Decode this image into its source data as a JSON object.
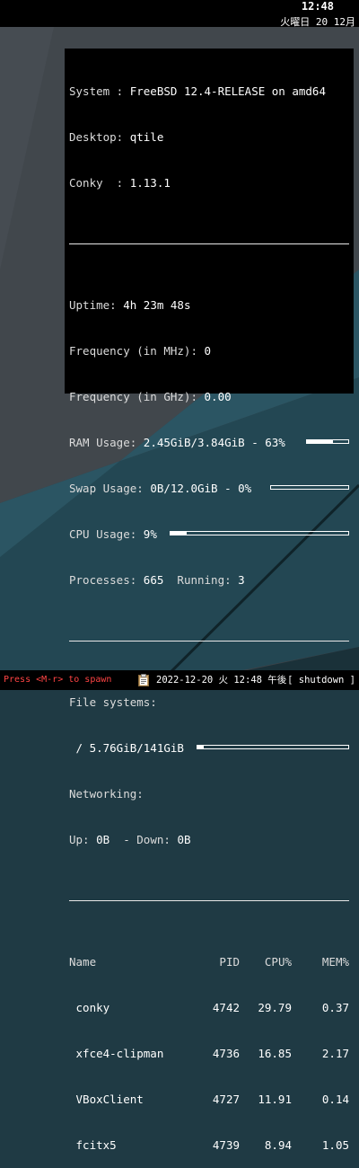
{
  "clock": {
    "time": "12:48",
    "date": "火曜日 20 12月"
  },
  "conky": {
    "system_label": "System : ",
    "system_value": "FreeBSD 12.4-RELEASE on amd64",
    "desktop_label": "Desktop: ",
    "desktop_value": "qtile",
    "conky_label": "Conky  : ",
    "conky_value": "1.13.1",
    "uptime_label": "Uptime: ",
    "uptime_value": "4h 23m 48s",
    "freq_mhz_label": "Frequency (in MHz): ",
    "freq_mhz_value": "0",
    "freq_ghz_label": "Frequency (in GHz): ",
    "freq_ghz_value": "0.00",
    "ram_label": "RAM Usage: ",
    "ram_value": "2.45GiB/3.84GiB - 63%",
    "ram_fraction": 0.63,
    "swap_label": "Swap Usage: ",
    "swap_value": "0B/12.0GiB - 0%",
    "swap_fraction": 0.0,
    "cpu_label": "CPU Usage: ",
    "cpu_value": "9%",
    "cpu_fraction": 0.09,
    "processes_label": "Processes: ",
    "processes_value": "665",
    "running_label": "  Running: ",
    "running_value": "3",
    "fs_label": "File systems:",
    "fs_value": " / 5.76GiB/141GiB",
    "fs_fraction": 0.04,
    "net_label": "Networking:",
    "up_label": "Up: ",
    "up_value": "0B",
    "down_label": "  - Down: ",
    "down_value": "0B",
    "proc_headers": {
      "name": "Name",
      "pid": "PID",
      "cpu": "CPU%",
      "mem": "MEM%"
    },
    "procs": [
      {
        "name": " conky",
        "pid": "4742",
        "cpu": "29.79",
        "mem": "0.37"
      },
      {
        "name": " xfce4-clipman",
        "pid": "4736",
        "cpu": "16.85",
        "mem": "2.17"
      },
      {
        "name": " VBoxClient",
        "pid": "4727",
        "cpu": "11.91",
        "mem": "0.14"
      },
      {
        "name": " fcitx5",
        "pid": "4739",
        "cpu": "8.94",
        "mem": "1.05"
      }
    ]
  },
  "bottombar": {
    "prompt": "Press <M-r> to spawn",
    "datetime": "2022-12-20 火 12:48 午後",
    "shutdown": "[ shutdown ]",
    "clipboard_icon": "clipboard-icon"
  },
  "colors": {
    "prompt": "#ff4444",
    "panel_bg": "#000000",
    "accent_teal": "#2b4f5b"
  }
}
